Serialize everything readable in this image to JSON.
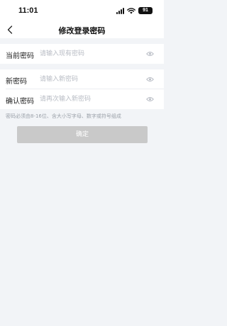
{
  "status_bar": {
    "time": "11:01",
    "battery": "91",
    "icons": [
      "signal-icon",
      "wifi-icon",
      "battery-icon"
    ]
  },
  "nav": {
    "title": "修改登录密码",
    "back_icon": "chevron-left-icon"
  },
  "fields": {
    "current": {
      "label": "当前密码",
      "placeholder": "请输入现有密码",
      "value": ""
    },
    "new": {
      "label": "新密码",
      "placeholder": "请输入新密码",
      "value": ""
    },
    "confirm": {
      "label": "确认密码",
      "placeholder": "请再次输入新密码",
      "value": ""
    }
  },
  "hint": "密码必须由8-16位、含大小写字母、数字或符号组成",
  "confirm_button": {
    "label": "确定",
    "enabled": false
  },
  "colors": {
    "background": "#f2f4f7",
    "button_disabled": "#c9c9c9",
    "placeholder": "#b8bcc4",
    "hint": "#9aa0a8"
  }
}
